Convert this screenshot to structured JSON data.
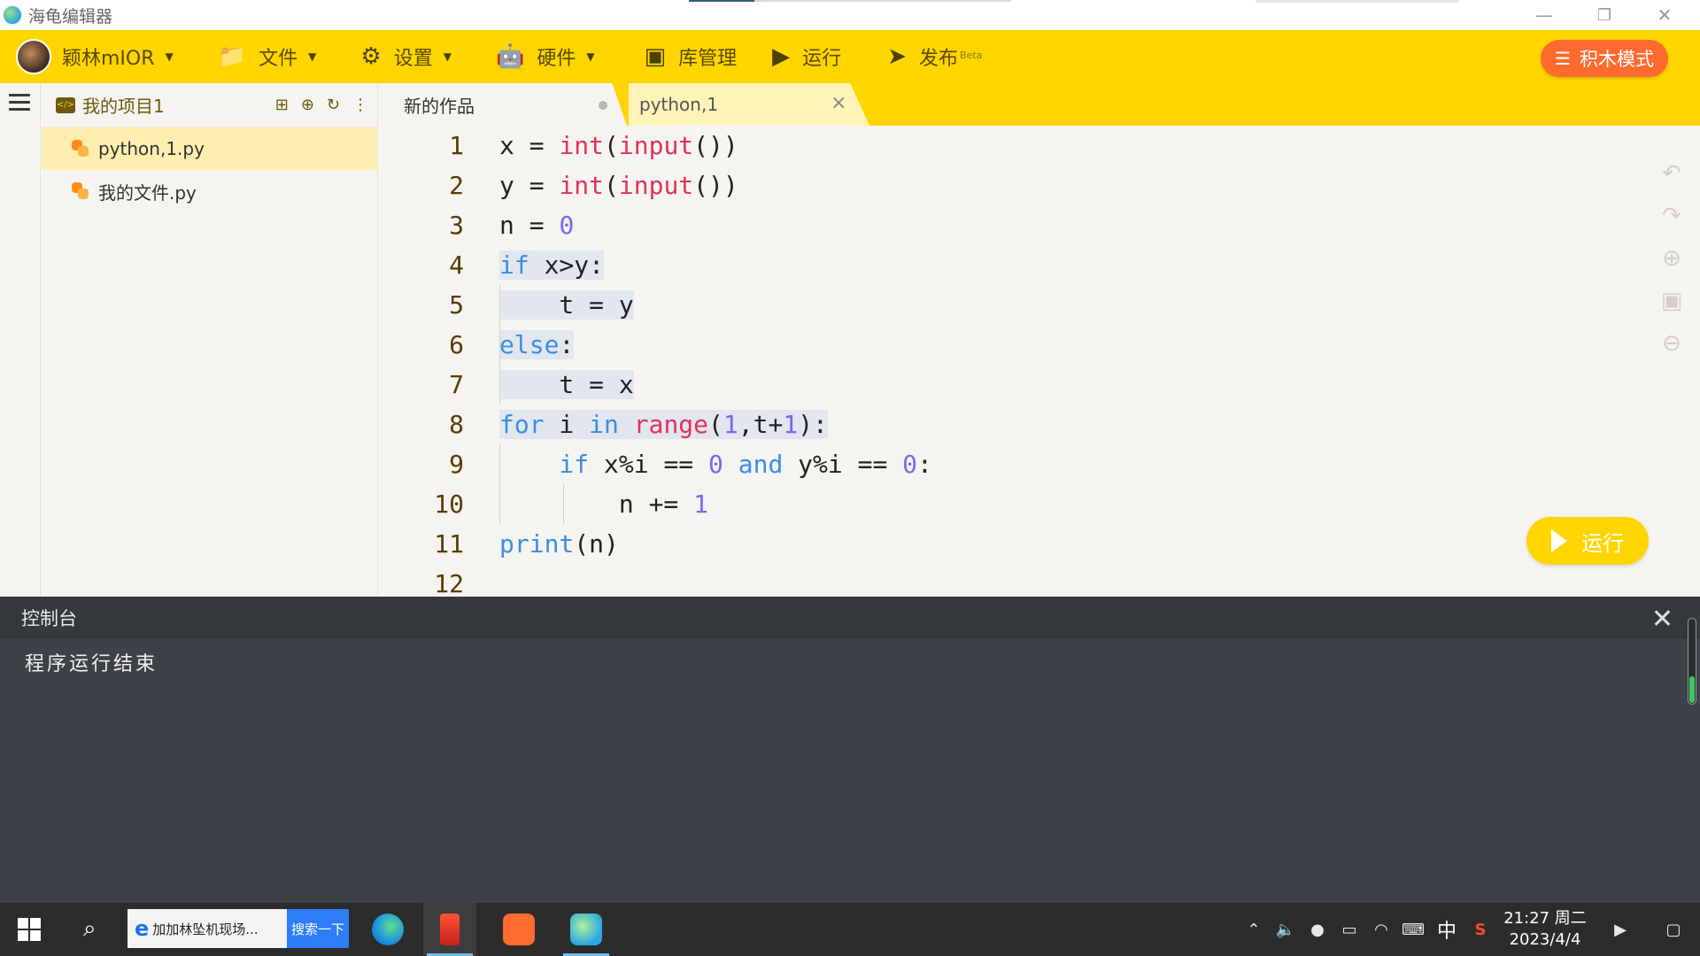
{
  "window": {
    "title": "海龟编辑器",
    "minimize": "—",
    "restore": "❐",
    "close": "✕"
  },
  "toolbar": {
    "user": "颖林mIOR",
    "file": "文件",
    "settings": "设置",
    "hardware": "硬件",
    "library": "库管理",
    "run": "运行",
    "publish": "发布",
    "publish_badge": "Beta",
    "block_mode": "积木模式",
    "accent_color": "#ffd500",
    "block_mode_color": "#ff6a2f"
  },
  "explorer": {
    "project": "我的项目1",
    "files": [
      {
        "name": "python,1.py",
        "active": true
      },
      {
        "name": "我的文件.py",
        "active": false
      }
    ]
  },
  "tabs": [
    {
      "label": "新的作品",
      "active": true
    },
    {
      "label": "python,1",
      "active": false
    }
  ],
  "editor": {
    "line_numbers": [
      "1",
      "2",
      "3",
      "4",
      "5",
      "6",
      "7",
      "8",
      "9",
      "10",
      "11",
      "12"
    ],
    "lines": [
      [
        {
          "t": "x = "
        },
        {
          "t": "int",
          "c": "fn"
        },
        {
          "t": "("
        },
        {
          "t": "input",
          "c": "fn"
        },
        {
          "t": "())"
        }
      ],
      [
        {
          "t": "y = "
        },
        {
          "t": "int",
          "c": "fn"
        },
        {
          "t": "("
        },
        {
          "t": "input",
          "c": "fn"
        },
        {
          "t": "())"
        }
      ],
      [
        {
          "t": "n = "
        },
        {
          "t": "0",
          "c": "num"
        }
      ],
      [
        {
          "t": "if",
          "c": "kw"
        },
        {
          "t": " x>y:"
        }
      ],
      [
        {
          "t": "    t = y"
        }
      ],
      [
        {
          "t": "else",
          "c": "kw"
        },
        {
          "t": ":"
        }
      ],
      [
        {
          "t": "    t = x"
        }
      ],
      [
        {
          "t": "for",
          "c": "kw"
        },
        {
          "t": " i "
        },
        {
          "t": "in",
          "c": "kw"
        },
        {
          "t": " "
        },
        {
          "t": "range",
          "c": "fn"
        },
        {
          "t": "("
        },
        {
          "t": "1",
          "c": "num"
        },
        {
          "t": ",t+"
        },
        {
          "t": "1",
          "c": "num"
        },
        {
          "t": "):"
        }
      ],
      [
        {
          "t": "    "
        },
        {
          "t": "if",
          "c": "kw"
        },
        {
          "t": " x%i == "
        },
        {
          "t": "0",
          "c": "num"
        },
        {
          "t": " "
        },
        {
          "t": "and",
          "c": "kw"
        },
        {
          "t": " y%i == "
        },
        {
          "t": "0",
          "c": "num"
        },
        {
          "t": ":"
        }
      ],
      [
        {
          "t": "        n += "
        },
        {
          "t": "1",
          "c": "num"
        }
      ],
      [
        {
          "t": "print",
          "c": "kw"
        },
        {
          "t": "(n)"
        }
      ],
      []
    ],
    "highlighted_lines": [
      4,
      5,
      6,
      7,
      8
    ],
    "run_button": "运行"
  },
  "console": {
    "title": "控制台",
    "output": "程序运行结束",
    "close": "✕"
  },
  "taskbar": {
    "ie_text": "加加林坠机现场...",
    "ie_button": "搜索一下",
    "ime": "中",
    "time": "21:27 周二",
    "date": "2023/4/4"
  }
}
